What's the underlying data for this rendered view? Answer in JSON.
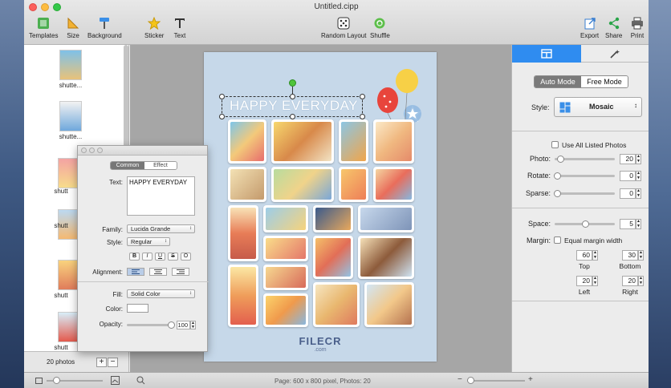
{
  "window": {
    "title": "Untitled.cipp"
  },
  "toolbar": {
    "templates_label": "Templates",
    "size_label": "Size",
    "background_label": "Background",
    "sticker_label": "Sticker",
    "text_label": "Text",
    "random_layout_label": "Random Layout",
    "shuffle_label": "Shuffle",
    "export_label": "Export",
    "share_label": "Share",
    "print_label": "Print"
  },
  "photo_list": {
    "items": [
      {
        "label": "shutte..."
      },
      {
        "label": "shutte..."
      },
      {
        "label": "shutt"
      },
      {
        "label": "shutt"
      },
      {
        "label": "shutt"
      },
      {
        "label": "shutt"
      },
      {
        "label": "shutt"
      }
    ],
    "count_label": "20 photos",
    "add_symbol": "+",
    "remove_symbol": "−"
  },
  "canvas": {
    "text": "HAPPY EVERYDAY",
    "watermark": "FILECR",
    "watermark_sub": ".com"
  },
  "text_inspector": {
    "tab_common": "Common",
    "tab_effect": "Effect",
    "text_label": "Text:",
    "text_value": "HAPPY EVERYDAY",
    "family_label": "Family:",
    "family_value": "Lucida Grande",
    "style_label": "Style:",
    "style_value": "Regular",
    "format_buttons": [
      "B",
      "I",
      "U",
      "S",
      "O"
    ],
    "alignment_label": "Alignment:",
    "fill_label": "Fill:",
    "fill_value": "Solid Color",
    "color_label": "Color:",
    "opacity_label": "Opacity:",
    "opacity_value": "100",
    "opacity_fraction": 1.0
  },
  "layout_panel": {
    "auto_mode": "Auto Mode",
    "free_mode": "Free Mode",
    "style_label": "Style:",
    "style_value": "Mosaic",
    "use_all_label": "Use All Listed Photos",
    "photo_label": "Photo:",
    "photo_value": "20",
    "rotate_label": "Rotate:",
    "rotate_value": "0",
    "sparse_label": "Sparse:",
    "sparse_value": "0",
    "space_label": "Space:",
    "space_value": "5",
    "margin_label": "Margin:",
    "equal_margin_label": "Equal margin width",
    "top_value": "60",
    "top_label": "Top",
    "bottom_value": "30",
    "bottom_label": "Bottom",
    "left_value": "20",
    "left_label": "Left",
    "right_value": "20",
    "right_label": "Right"
  },
  "status_bar": {
    "info": "Page: 600 x 800 pixel, Photos: 20"
  },
  "colors": {
    "accent": "#2f8cf0",
    "page_background": "#c6d8e9",
    "canvas_background": "#a6a6a6"
  }
}
